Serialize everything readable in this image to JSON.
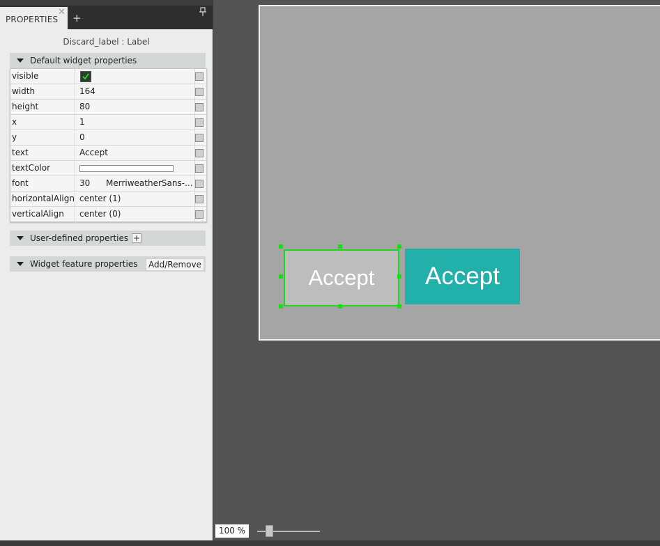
{
  "panel": {
    "tab_label": "PROPERTIES",
    "tab_close_glyph": "✕",
    "tab_add_glyph": "+",
    "pin_icon": "pin-icon",
    "widget_title": "Discard_label : Label"
  },
  "sections": {
    "default": {
      "title": "Default widget properties"
    },
    "user_defined": {
      "title": "User-defined properties",
      "add_glyph": "+"
    },
    "widget_feature": {
      "title": "Widget feature properties",
      "add_remove_label": "Add/Remove"
    }
  },
  "properties": [
    {
      "name": "visible",
      "value": "",
      "checked": true
    },
    {
      "name": "width",
      "value": "164"
    },
    {
      "name": "height",
      "value": "80"
    },
    {
      "name": "x",
      "value": "1"
    },
    {
      "name": "y",
      "value": "0"
    },
    {
      "name": "text",
      "value": "Accept"
    },
    {
      "name": "textColor",
      "value": "",
      "color": "#ffffff"
    },
    {
      "name": "font",
      "size": "30",
      "family": "MerriweatherSans-..."
    },
    {
      "name": "horizontalAlign",
      "value": "center (1)"
    },
    {
      "name": "verticalAlign",
      "value": "center (0)"
    }
  ],
  "canvas": {
    "background": "#a5a5a5",
    "discard_label": {
      "text": "Accept",
      "background": "#bdbdbd",
      "selection_color": "#1fd61f"
    },
    "accept_button": {
      "text": "Accept",
      "background": "#21b0aa"
    }
  },
  "zoom": {
    "value": "100 %",
    "level_fraction": 0.15
  }
}
